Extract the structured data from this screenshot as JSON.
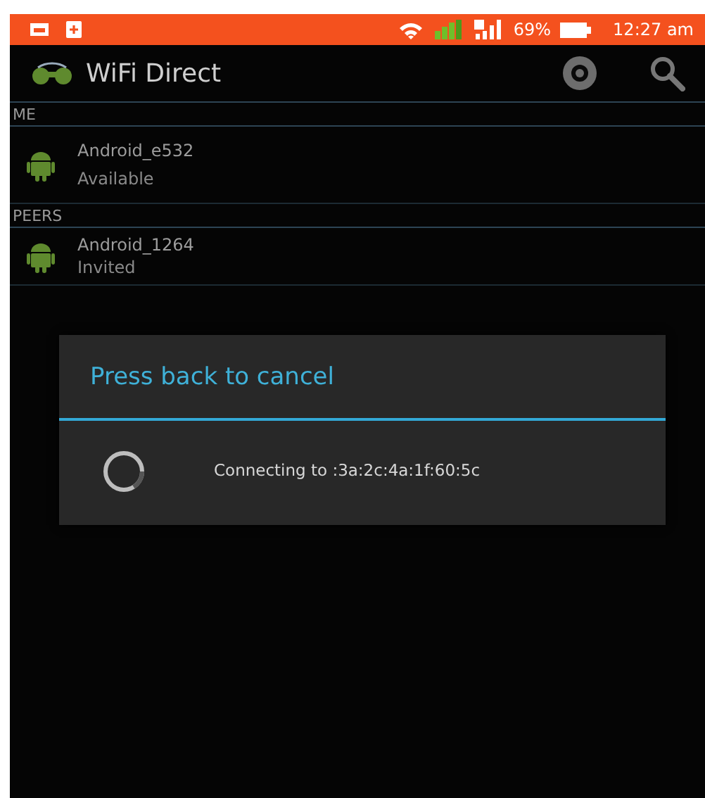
{
  "status_bar": {
    "battery": "69%",
    "time": "12:27 am"
  },
  "action_bar": {
    "title": "WiFi Direct"
  },
  "sections": [
    {
      "header": "ME",
      "devices": [
        {
          "name": "Android_e532",
          "status": "Available"
        }
      ]
    },
    {
      "header": "PEERS",
      "devices": [
        {
          "name": "Android_1264",
          "status": "Invited"
        }
      ]
    }
  ],
  "dialog": {
    "title": "Press back to cancel",
    "message": "Connecting to :3a:2c:4a:1f:60:5c"
  }
}
